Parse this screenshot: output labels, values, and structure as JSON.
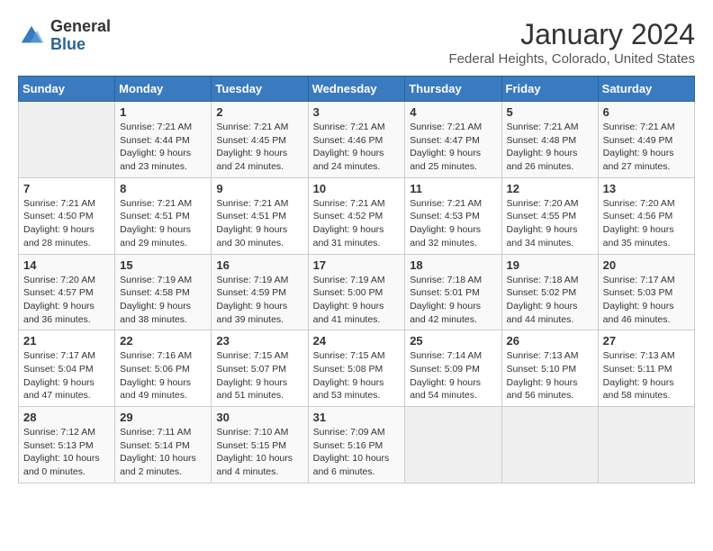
{
  "header": {
    "logo_general": "General",
    "logo_blue": "Blue",
    "title": "January 2024",
    "subtitle": "Federal Heights, Colorado, United States"
  },
  "calendar": {
    "days_of_week": [
      "Sunday",
      "Monday",
      "Tuesday",
      "Wednesday",
      "Thursday",
      "Friday",
      "Saturday"
    ],
    "weeks": [
      [
        {
          "day": "",
          "info": ""
        },
        {
          "day": "1",
          "info": "Sunrise: 7:21 AM\nSunset: 4:44 PM\nDaylight: 9 hours\nand 23 minutes."
        },
        {
          "day": "2",
          "info": "Sunrise: 7:21 AM\nSunset: 4:45 PM\nDaylight: 9 hours\nand 24 minutes."
        },
        {
          "day": "3",
          "info": "Sunrise: 7:21 AM\nSunset: 4:46 PM\nDaylight: 9 hours\nand 24 minutes."
        },
        {
          "day": "4",
          "info": "Sunrise: 7:21 AM\nSunset: 4:47 PM\nDaylight: 9 hours\nand 25 minutes."
        },
        {
          "day": "5",
          "info": "Sunrise: 7:21 AM\nSunset: 4:48 PM\nDaylight: 9 hours\nand 26 minutes."
        },
        {
          "day": "6",
          "info": "Sunrise: 7:21 AM\nSunset: 4:49 PM\nDaylight: 9 hours\nand 27 minutes."
        }
      ],
      [
        {
          "day": "7",
          "info": "Sunrise: 7:21 AM\nSunset: 4:50 PM\nDaylight: 9 hours\nand 28 minutes."
        },
        {
          "day": "8",
          "info": "Sunrise: 7:21 AM\nSunset: 4:51 PM\nDaylight: 9 hours\nand 29 minutes."
        },
        {
          "day": "9",
          "info": "Sunrise: 7:21 AM\nSunset: 4:51 PM\nDaylight: 9 hours\nand 30 minutes."
        },
        {
          "day": "10",
          "info": "Sunrise: 7:21 AM\nSunset: 4:52 PM\nDaylight: 9 hours\nand 31 minutes."
        },
        {
          "day": "11",
          "info": "Sunrise: 7:21 AM\nSunset: 4:53 PM\nDaylight: 9 hours\nand 32 minutes."
        },
        {
          "day": "12",
          "info": "Sunrise: 7:20 AM\nSunset: 4:55 PM\nDaylight: 9 hours\nand 34 minutes."
        },
        {
          "day": "13",
          "info": "Sunrise: 7:20 AM\nSunset: 4:56 PM\nDaylight: 9 hours\nand 35 minutes."
        }
      ],
      [
        {
          "day": "14",
          "info": "Sunrise: 7:20 AM\nSunset: 4:57 PM\nDaylight: 9 hours\nand 36 minutes."
        },
        {
          "day": "15",
          "info": "Sunrise: 7:19 AM\nSunset: 4:58 PM\nDaylight: 9 hours\nand 38 minutes."
        },
        {
          "day": "16",
          "info": "Sunrise: 7:19 AM\nSunset: 4:59 PM\nDaylight: 9 hours\nand 39 minutes."
        },
        {
          "day": "17",
          "info": "Sunrise: 7:19 AM\nSunset: 5:00 PM\nDaylight: 9 hours\nand 41 minutes."
        },
        {
          "day": "18",
          "info": "Sunrise: 7:18 AM\nSunset: 5:01 PM\nDaylight: 9 hours\nand 42 minutes."
        },
        {
          "day": "19",
          "info": "Sunrise: 7:18 AM\nSunset: 5:02 PM\nDaylight: 9 hours\nand 44 minutes."
        },
        {
          "day": "20",
          "info": "Sunrise: 7:17 AM\nSunset: 5:03 PM\nDaylight: 9 hours\nand 46 minutes."
        }
      ],
      [
        {
          "day": "21",
          "info": "Sunrise: 7:17 AM\nSunset: 5:04 PM\nDaylight: 9 hours\nand 47 minutes."
        },
        {
          "day": "22",
          "info": "Sunrise: 7:16 AM\nSunset: 5:06 PM\nDaylight: 9 hours\nand 49 minutes."
        },
        {
          "day": "23",
          "info": "Sunrise: 7:15 AM\nSunset: 5:07 PM\nDaylight: 9 hours\nand 51 minutes."
        },
        {
          "day": "24",
          "info": "Sunrise: 7:15 AM\nSunset: 5:08 PM\nDaylight: 9 hours\nand 53 minutes."
        },
        {
          "day": "25",
          "info": "Sunrise: 7:14 AM\nSunset: 5:09 PM\nDaylight: 9 hours\nand 54 minutes."
        },
        {
          "day": "26",
          "info": "Sunrise: 7:13 AM\nSunset: 5:10 PM\nDaylight: 9 hours\nand 56 minutes."
        },
        {
          "day": "27",
          "info": "Sunrise: 7:13 AM\nSunset: 5:11 PM\nDaylight: 9 hours\nand 58 minutes."
        }
      ],
      [
        {
          "day": "28",
          "info": "Sunrise: 7:12 AM\nSunset: 5:13 PM\nDaylight: 10 hours\nand 0 minutes."
        },
        {
          "day": "29",
          "info": "Sunrise: 7:11 AM\nSunset: 5:14 PM\nDaylight: 10 hours\nand 2 minutes."
        },
        {
          "day": "30",
          "info": "Sunrise: 7:10 AM\nSunset: 5:15 PM\nDaylight: 10 hours\nand 4 minutes."
        },
        {
          "day": "31",
          "info": "Sunrise: 7:09 AM\nSunset: 5:16 PM\nDaylight: 10 hours\nand 6 minutes."
        },
        {
          "day": "",
          "info": ""
        },
        {
          "day": "",
          "info": ""
        },
        {
          "day": "",
          "info": ""
        }
      ]
    ]
  }
}
